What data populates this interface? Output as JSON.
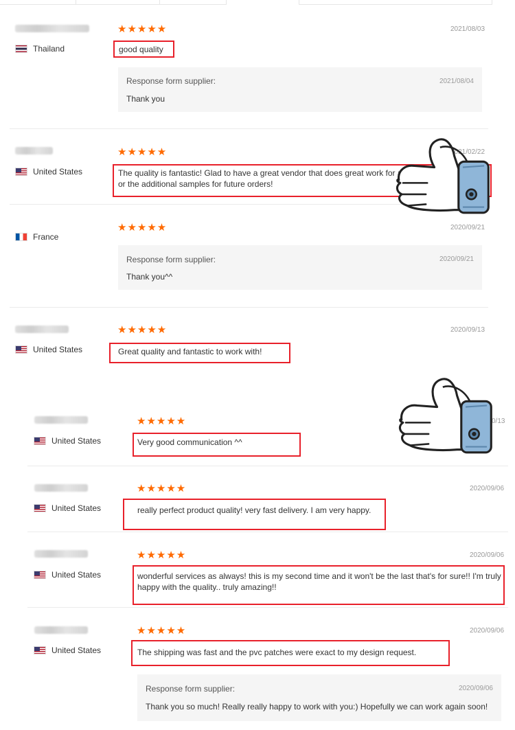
{
  "response_heading": "Response form supplier:",
  "panel1": {
    "reviews": [
      {
        "country": "Thailand",
        "flag": "th",
        "stars": "★★★★★",
        "date": "2021/08/03",
        "text": "good quality",
        "response": {
          "date": "2021/08/04",
          "text": "Thank you"
        }
      },
      {
        "country": "United States",
        "flag": "us",
        "stars": "★★★★★",
        "date": "2021/02/22",
        "text": "The quality is fantastic! Glad to have a great vendor that does great work for a",
        "text2": "or the additional samples for future orders!"
      },
      {
        "country": "France",
        "flag": "fr",
        "stars": "★★★★★",
        "date": "2020/09/21",
        "response": {
          "date": "2020/09/21",
          "text": "Thank you^^"
        }
      },
      {
        "country": "United States",
        "flag": "us",
        "stars": "★★★★★",
        "date": "2020/09/13",
        "text": "Great quality and fantastic to work with!"
      }
    ]
  },
  "panel2": {
    "reviews": [
      {
        "country": "United States",
        "flag": "us",
        "stars": "★★★★★",
        "date": "0/13",
        "text": "Very good communication ^^"
      },
      {
        "country": "United States",
        "flag": "us",
        "stars": "★★★★★",
        "date": "2020/09/06",
        "text": "really perfect product quality! very fast delivery. I am very happy."
      },
      {
        "country": "United States",
        "flag": "us",
        "stars": "★★★★★",
        "date": "2020/09/06",
        "text": "wonderful services as always! this is my second time and it won't be the last that's for sure!! I'm truly",
        "text2": "happy with the quality.. truly amazing!!"
      },
      {
        "country": "United States",
        "flag": "us",
        "stars": "★★★★★",
        "date": "2020/09/06",
        "text": "The shipping was fast and the pvc patches were exact to my design request.",
        "response": {
          "date": "2020/09/06",
          "text": "Thank you so much! Really really happy to work with you:) Hopefully we can work again soon!"
        }
      }
    ]
  },
  "icons": {
    "thumbs_up": "thumbs-up-icon",
    "star": "star-icon"
  },
  "colors": {
    "star": "#ff6a00",
    "highlight": "#e8202a",
    "response_bg": "#f5f5f5",
    "cuff": "#8fb6d8"
  }
}
